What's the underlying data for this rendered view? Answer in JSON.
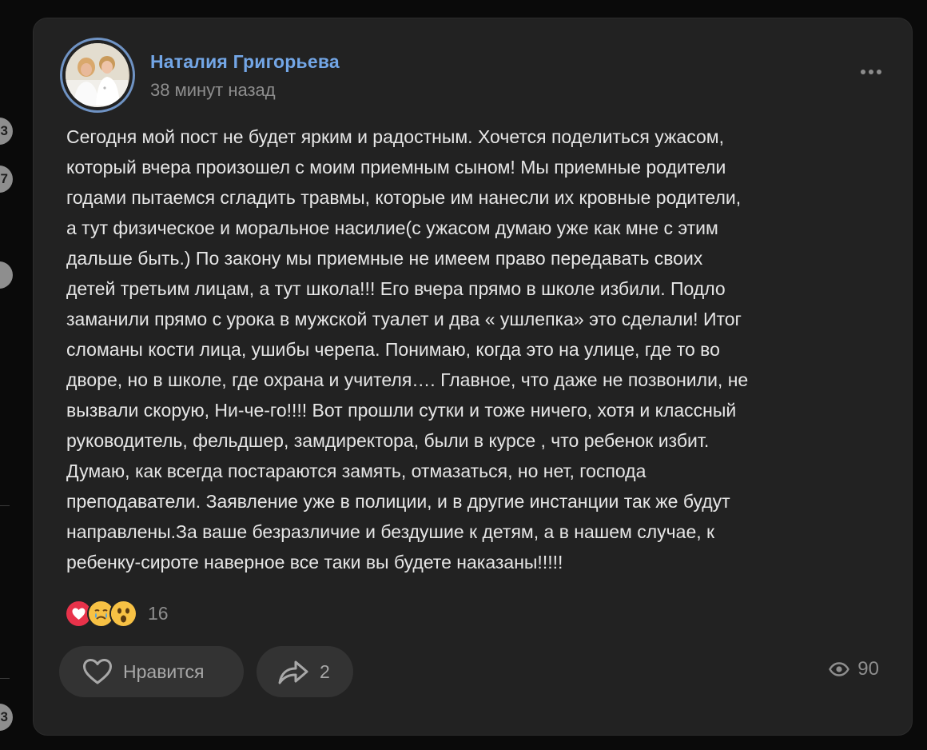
{
  "edge": {
    "dot1": "3",
    "dot2": "7",
    "dot3": "",
    "dot4": "3"
  },
  "post": {
    "author": "Наталия Григорьева",
    "time": "38 минут назад",
    "text": "Сегодня мой пост не будет ярким и радостным. Хочется поделиться ужасом,\nкоторый вчера произошел с моим приемным сыном! Мы приемные родители\nгодами пытаемся сгладить травмы, которые им нанесли их кровные родители,\nа тут физическое и моральное насилие(с ужасом думаю уже как мне с этим\nдальше быть.) По закону мы приемные не имеем право передавать своих\nдетей третьим лицам, а тут школа!!! Его вчера прямо в школе избили. Подло\nзаманили прямо с урока в мужской туалет и два « ушлепка» это сделали! Итог\nсломаны кости лица, ушибы черепа. Понимаю, когда это на улице, где то во\nдворе, но в школе, где охрана и учителя…. Главное, что даже не позвонили, не\nвызвали скорую, Ни-че-го!!!! Вот прошли сутки и тоже ничего, хотя и классный\nруководитель, фельдшер, замдиректора, были в курсе , что ребенок избит.\nДумаю, как всегда постараются замять, отмазаться, но нет, господа\nпреподаватели. Заявление уже в полиции, и в другие инстанции так же будут\nнаправлены.За ваше безразличие и бездушие к детям, а в нашем случае, к\nребенку-сироте наверное все таки вы будете наказаны!!!!!",
    "reactions": {
      "icons": [
        "heart-reaction",
        "crying-reaction",
        "surprised-reaction"
      ],
      "count": "16"
    },
    "like_label": "Нравится",
    "share_count": "2",
    "views_count": "90"
  },
  "colors": {
    "background": "#0a0a0a",
    "card": "#222222",
    "author_link": "#73a6e6",
    "muted": "#8e8e8e",
    "body_text": "#e6e6e6",
    "button": "#333333"
  }
}
